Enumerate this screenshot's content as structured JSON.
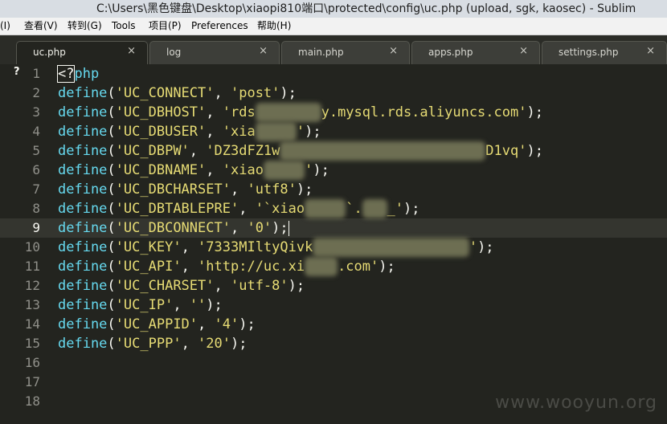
{
  "window": {
    "title": "C:\\Users\\黑色键盘\\Desktop\\xiaopi810端口\\protected\\config\\uc.php (upload, sgk, kaosec) - Sublim"
  },
  "menu": [
    "(I)",
    "查看(V)",
    "转到(G)",
    "Tools",
    "项目(P)",
    "Preferences",
    "帮助(H)"
  ],
  "tabs": [
    {
      "label": "uc.php",
      "close": "×"
    },
    {
      "label": "log",
      "close": "×"
    },
    {
      "label": "main.php",
      "close": "×"
    },
    {
      "label": "apps.php",
      "close": "×"
    },
    {
      "label": "settings.php",
      "close": "×"
    }
  ],
  "gutter_mark": "?",
  "line_numbers": [
    "1",
    "2",
    "3",
    "4",
    "5",
    "6",
    "7",
    "8",
    "9",
    "10",
    "11",
    "12",
    "13",
    "14",
    "15",
    "16",
    "17",
    "18"
  ],
  "current_line": "9",
  "code": {
    "l1": {
      "open": "<?",
      "rest": "php"
    },
    "kw": "define",
    "l2": {
      "key": "'UC_CONNECT'",
      "val": "'post'"
    },
    "l3": {
      "key": "'UC_DBHOST'",
      "v1": "'rds",
      "blur": "xxxxxxxx",
      "v2": "y.mysql.rds.aliyuncs.com'"
    },
    "l4": {
      "key": "'UC_DBUSER'",
      "v1": "'xia",
      "blur": "xxxxx",
      "v2": "'"
    },
    "l5": {
      "key": "'UC_DBPW'",
      "v1": "'DZ3dFZ1w",
      "blur": "xxxxxxxxxxxxxxxxxxxxxxxxx",
      "v2": "D1vq'"
    },
    "l6": {
      "key": "'UC_DBNAME'",
      "v1": "'xiao",
      "blur": "xxxxx",
      "v2": "'"
    },
    "l7": {
      "key": "'UC_DBCHARSET'",
      "val": "'utf8'"
    },
    "l8": {
      "key": "'UC_DBTABLEPRE'",
      "v1": "'`xiao",
      "blur": "xxxxx",
      "v2": "`.",
      "blur2": "xxx",
      "v3": "_'"
    },
    "l9": {
      "key": "'UC_DBCONNECT'",
      "val": "'0'"
    },
    "l10": {
      "key": "'UC_KEY'",
      "v1": "'7333MIltyQivk",
      "blur": "xxxxxxxxxxxxxxxxxxx",
      "v2": "'"
    },
    "l11": {
      "key": "'UC_API'",
      "v1": "'http://uc.xi",
      "blur": "xxxx",
      "v2": ".com'"
    },
    "l12": {
      "key": "'UC_CHARSET'",
      "val": "'utf-8'"
    },
    "l13": {
      "key": "'UC_IP'",
      "val": "''"
    },
    "l14": {
      "key": "'UC_APPID'",
      "val": "'4'"
    },
    "l15": {
      "key": "'UC_PPP'",
      "val": "'20'"
    }
  },
  "punct": {
    "open": "(",
    "comma": ", ",
    "close": ");"
  },
  "watermark": "www.wooyun.org",
  "colors": {
    "background": "#23241f",
    "keyword": "#66d9ef",
    "string": "#e6db74",
    "text": "#f8f8f2",
    "gutter": "#90908a"
  }
}
